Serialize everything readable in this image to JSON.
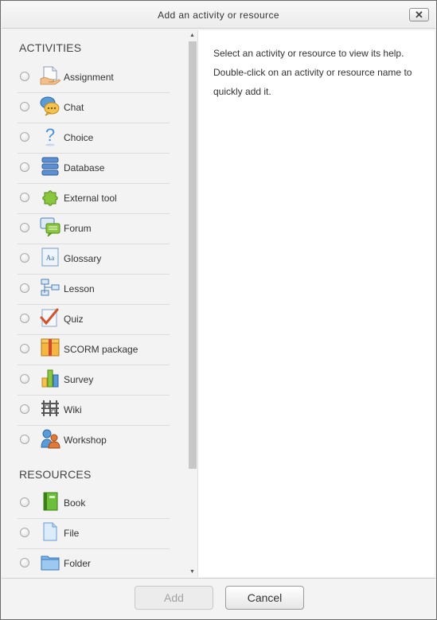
{
  "dialog": {
    "title": "Add an activity or resource",
    "close_label": "✕"
  },
  "activities": {
    "header": "ACTIVITIES",
    "items": [
      {
        "label": "Assignment",
        "icon": "assignment-icon"
      },
      {
        "label": "Chat",
        "icon": "chat-icon"
      },
      {
        "label": "Choice",
        "icon": "choice-icon"
      },
      {
        "label": "Database",
        "icon": "database-icon"
      },
      {
        "label": "External tool",
        "icon": "external-tool-icon"
      },
      {
        "label": "Forum",
        "icon": "forum-icon"
      },
      {
        "label": "Glossary",
        "icon": "glossary-icon"
      },
      {
        "label": "Lesson",
        "icon": "lesson-icon"
      },
      {
        "label": "Quiz",
        "icon": "quiz-icon"
      },
      {
        "label": "SCORM package",
        "icon": "scorm-package-icon"
      },
      {
        "label": "Survey",
        "icon": "survey-icon"
      },
      {
        "label": "Wiki",
        "icon": "wiki-icon"
      },
      {
        "label": "Workshop",
        "icon": "workshop-icon"
      }
    ]
  },
  "resources": {
    "header": "RESOURCES",
    "items": [
      {
        "label": "Book",
        "icon": "book-icon"
      },
      {
        "label": "File",
        "icon": "file-icon"
      },
      {
        "label": "Folder",
        "icon": "folder-icon"
      }
    ]
  },
  "help": {
    "text": "Select an activity or resource to view its help. Double-click on an activity or resource name to quickly add it."
  },
  "footer": {
    "add_label": "Add",
    "cancel_label": "Cancel"
  },
  "colors": {
    "dialog_bg": "#f3f3f3",
    "panel_bg": "#ffffff",
    "border": "#6b6b6b",
    "disabled_text": "#a2a2a2"
  }
}
